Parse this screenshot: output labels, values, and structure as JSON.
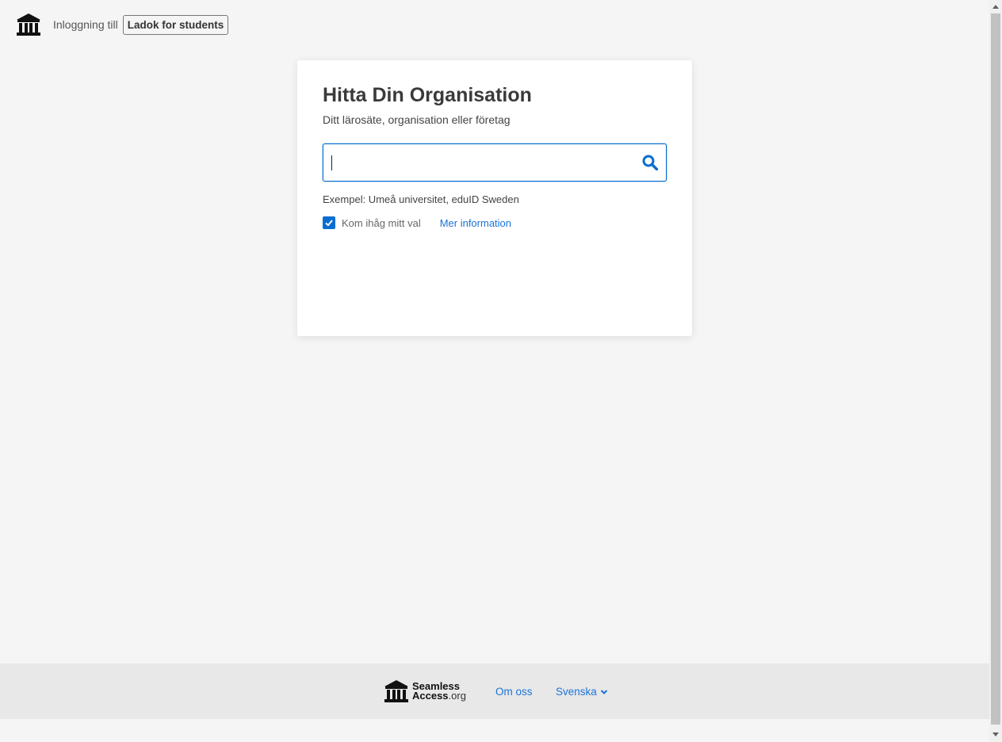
{
  "header": {
    "logo_icon": "institution-icon",
    "login_text": "Inloggning till",
    "service_name": "Ladok for students"
  },
  "card": {
    "title": "Hitta Din Organisation",
    "subtitle": "Ditt lärosäte, organisation eller företag",
    "search": {
      "value": "",
      "placeholder": "",
      "icon": "search-icon"
    },
    "example_text": "Exempel: Umeå universitet, eduID Sweden",
    "remember": {
      "label": "Kom ihåg mitt val",
      "checked": true
    },
    "more_info_link": "Mer information"
  },
  "footer": {
    "brand_line1": "Seamless",
    "brand_line2": "Access",
    "brand_suffix": ".org",
    "about_link": "Om oss",
    "language": "Svenska"
  },
  "colors": {
    "accent": "#0a6ed1",
    "link": "#1a73d9",
    "background": "#f5f5f5",
    "footer_bg": "#e8e8e8"
  }
}
